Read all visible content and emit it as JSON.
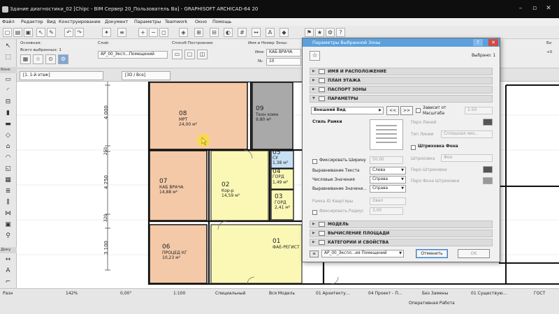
{
  "window": {
    "title": "Здание диагностики_02 [Chipc - BIM Сервер 20_Пользователь Ba] - GRAPHISOFT ARCHICAD-64 20"
  },
  "menu": [
    "Файл",
    "Редактор",
    "Вид",
    "Конструирование",
    "Документ",
    "Параметры",
    "Teamwork",
    "Окно",
    "Помощь"
  ],
  "infobox": {
    "basic_label": "Основная:",
    "selected_label": "Всего выбранных: 1",
    "layer_label": "Слой:",
    "layer_value": "АР_00_Эксп...Помещений",
    "method_label": "Способ Построения:",
    "name_number_label": "Имя и Номер Зоны:",
    "name_prefix": "Имя:",
    "name_value": "КАБ ВРАЧА",
    "number_prefix": "№:",
    "number_value": "10",
    "top_label": "Бо",
    "top_value": "+0",
    "floor_label": "[1. 1-й этаж]",
    "view_tab": "[3D / Все]",
    "view_tab_left": "[1. 1-й этаж]"
  },
  "toolbox": {
    "sections": [
      "Конс",
      "Доку",
      "Разн"
    ],
    "tools": [
      "arrow",
      "marquee",
      "wall",
      "door",
      "window",
      "column",
      "beam",
      "slab",
      "roof",
      "shell",
      "skylight",
      "curtain-wall",
      "stair",
      "railing",
      "mesh",
      "zone",
      "object",
      "lamp",
      "morph",
      "dimension",
      "level",
      "text",
      "label",
      "fill",
      "line"
    ]
  },
  "plan": {
    "dims": [
      "4 000",
      "250",
      "4 250",
      "320",
      "3 100"
    ],
    "rooms": [
      {
        "num": "08",
        "name": "МРТ",
        "area": "24,00 м²"
      },
      {
        "num": "09",
        "name": "Техн комн",
        "area": "9,80 м²"
      },
      {
        "num": "07",
        "name": "КАБ ВРАЧА",
        "area": "14,88 м²"
      },
      {
        "num": "02",
        "name": "Кор-р",
        "area": "14,59 м²"
      },
      {
        "num": "05",
        "name": "СУ",
        "area": "1,38 м²"
      },
      {
        "num": "04",
        "name": "ГОРД",
        "area": "1,49 м²"
      },
      {
        "num": "03",
        "name": "ГОРД",
        "area": "2,41 м²"
      },
      {
        "num": "06",
        "name": "ПРОЦЕД КГ",
        "area": "10,23 м²"
      },
      {
        "num": "01",
        "name": "ФАЕ-РЕГИСТ",
        "area": ""
      }
    ]
  },
  "dialog": {
    "title": "Параметры Выбранной Зоны",
    "selected_count": "Выбрано: 1",
    "sections_top": [
      "ИМЯ И РАСПОЛОЖЕНИЕ",
      "ПЛАН ЭТАЖА",
      "ПАСПОРТ ЗОНЫ",
      "ПАРАМЕТРЫ"
    ],
    "sections_bottom": [
      "МОДЕЛЬ",
      "ВЫЧИСЛЕНИЕ ПЛОЩАДИ",
      "КАТЕГОРИИ И СВОЙСТВА"
    ],
    "params": {
      "view_select": "Внешний Вид",
      "prev": "<<",
      "next": ">>",
      "depends_scale_line1": "Зависит от",
      "depends_scale_line2": "Масштаба",
      "scale_value": "1:50",
      "frame_style_label": "Стиль Рамки",
      "pen_lines_label": "Перо Линий",
      "line_type_label": "Тип Линии",
      "line_type_value": "Сплошная лин...",
      "hatch_bg_label": "Штриховка Фона",
      "hatch_label": "Штриховка",
      "hatch_value": "Фон",
      "hatch_pen_label": "Перо Штриховки",
      "hatch_bg_pen_label": "Перо Фона Штриховки",
      "fix_width_label": "Фиксировать Ширину",
      "fix_width_value": "50,00",
      "text_align_label": "Выравнивание Текста",
      "text_align_value": "Слева",
      "num_values_label": "Числовые Значения",
      "num_values_value": "Справа",
      "align_values_label": "Выравнивание Значени...",
      "align_values_value": "Справа",
      "apt_id_frame_label": "Рамка ID Квартиры",
      "apt_id_frame_value": "Овал",
      "fix_radius_label": "Фиксировать Радиус",
      "fix_radius_value": "3,00"
    },
    "layer_value": "АР_00_Экспл...ия Помещений",
    "cancel_label": "Отменить",
    "ok_label": "OK"
  },
  "statusbar": {
    "items": [
      "142%",
      "0,00°",
      "1:100",
      "Специальный",
      "Вся Модель",
      "01 Архитекту...",
      "04 Проект - П...",
      "Без Замены",
      "01 Существую...",
      "ГОСТ"
    ],
    "mode_label": "Оперативная Работа"
  }
}
